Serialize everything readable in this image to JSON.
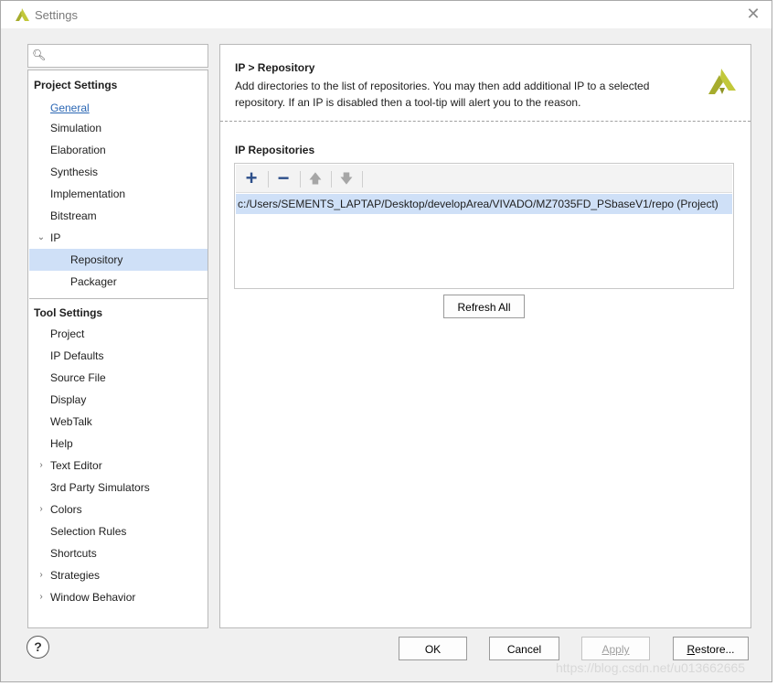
{
  "window": {
    "title": "Settings",
    "close_glyph": "✕"
  },
  "search": {
    "placeholder": "",
    "value": ""
  },
  "nav": {
    "project_settings_label": "Project Settings",
    "project_items": [
      "General",
      "Simulation",
      "Elaboration",
      "Synthesis",
      "Implementation",
      "Bitstream",
      "IP"
    ],
    "ip_children": [
      "Repository",
      "Packager"
    ],
    "tool_settings_label": "Tool Settings",
    "tool_items": [
      "Project",
      "IP Defaults",
      "Source File",
      "Display",
      "WebTalk",
      "Help",
      "Text Editor",
      "3rd Party Simulators",
      "Colors",
      "Selection Rules",
      "Shortcuts",
      "Strategies",
      "Window Behavior"
    ],
    "selected": "Repository"
  },
  "panel": {
    "breadcrumb": "IP > Repository",
    "description": "Add directories to the list of repositories. You may then add additional IP to a selected repository. If an IP is disabled then a tool-tip will alert you to the reason.",
    "repositories_title": "IP Repositories",
    "repositories": [
      "c:/Users/SEMENTS_LAPTAP/Desktop/developArea/VIVADO/MZ7035FD_PSbaseV1/repo (Project)"
    ],
    "refresh_label": "Refresh All",
    "toolbar_icons": [
      "add-icon",
      "remove-icon",
      "move-up-icon",
      "move-down-icon"
    ]
  },
  "footer": {
    "help_label": "?",
    "ok_label": "OK",
    "cancel_label": "Cancel",
    "apply_label": "Apply",
    "restore_first": "R",
    "restore_rest": "estore..."
  },
  "watermark": "https://blog.csdn.net/u013662665",
  "colors": {
    "accent": "#cfe0f7",
    "brand": "#a6ac2d",
    "link": "#2b67b4",
    "icon": "#2d4f8a"
  }
}
